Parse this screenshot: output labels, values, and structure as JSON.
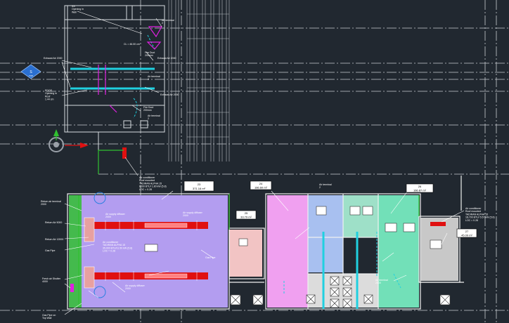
{
  "colors": {
    "background": "#212830",
    "grid": "#c8ccd2",
    "wall": "#e8e8e8",
    "zone_lavender": "#b39df0",
    "zone_pink": "#f0a0f0",
    "zone_salmon": "#f2c4c4",
    "zone_blue": "#a8c0f0",
    "zone_mint": "#72e0b8",
    "zone_gray": "#c8c8c8",
    "duct_red": "#e01010",
    "duct_cyan": "#20d0e0",
    "duct_magenta": "#e020e0",
    "green": "#30c030",
    "navcube": "#2a6fd0"
  },
  "viewcube": {
    "label": "S",
    "sublabel": "TOP"
  },
  "room_tags": [
    {
      "id": "23",
      "area": "371.16 m²"
    },
    {
      "id": "24",
      "area": "166.60 m²"
    },
    {
      "id": "25",
      "area": "33.79 m²"
    },
    {
      "id": "26",
      "area": "166.87 m²"
    },
    {
      "id": "27",
      "area": "45.09 m²"
    }
  ],
  "annotations": {
    "opening_wall": "SS\nOpening in\nWall",
    "air_terminal_1": "Air terminal\n2\n",
    "cl_note": "CL = 46.00 cm",
    "fire_duct": "Fire Duct\n200mm",
    "exhaust_a": "Exhaust Air 2000",
    "exhaust_b": "Exhaust Air 2000",
    "exhaust_c": "Exhaust Air 2000",
    "opening_roof": "EDOS\nOpening in\nRoof\n1.44 cm",
    "air_terminal_2": "Air terminal\n2\n",
    "fire_duct_2": "Fire Duct\n200mm",
    "air_terminal_3": "Air terminal\n2\n",
    "ac_note": "Air conditioner\nRoof mounted\nTADIRAN ALPHA 15\n8000 BTU/ 1.80 kW (5.8)\nLOC = 0.28",
    "return_terminal": "Return air terminal\n2000",
    "return_air": "Return Air 5000",
    "return_air_b": "Return Air 12000",
    "gas_pipe": "Gas Pipe",
    "fresh_air": "Fresh air Shutter\n4000",
    "gas_pipe_b": "Gas Pipe on\nTop Wall",
    "air_supply_1": "Air supply diffuser\n2000",
    "air_supply_2": "Air supply diffuser\n2000",
    "air_supply_3": "Air supply diffuser\n2000",
    "ac_unit_main": "Air conditioner\nTADIRAN ALPHA 15\n35,000 BTU/11.50 kW (5.8)\nLOC = 0.28",
    "ac_right": "Air conditioner\nRoof mounted\nTADIRAN ALPHA 15\n18,700 BTU/ 5.57 kW (5.8)\nLOC = 0.28",
    "air_terminal_4": "Air terminal\n2\n",
    "gas_pipe_c": "Gas Pipe",
    "air_terminal_5": "Air terminal\n2000"
  }
}
